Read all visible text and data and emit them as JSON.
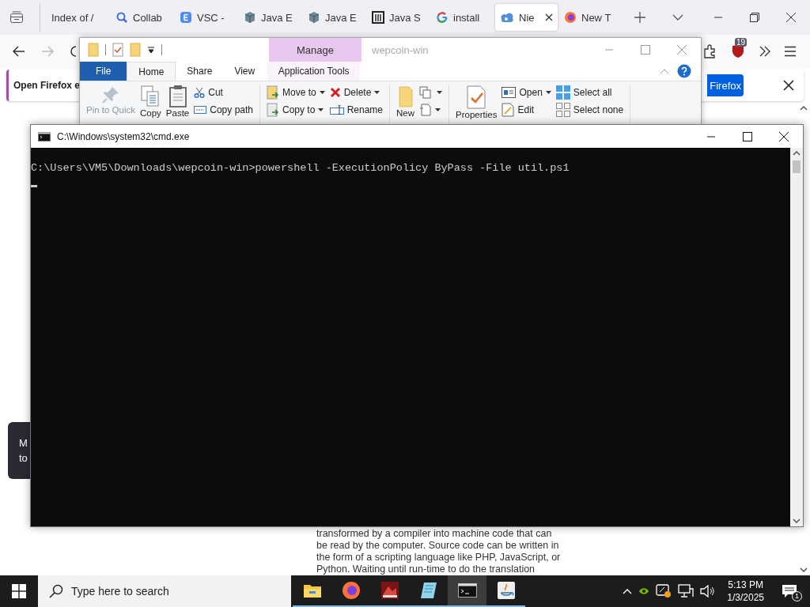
{
  "browser": {
    "tabs": [
      {
        "label": "Index of /",
        "kind": "blank",
        "selected": false
      },
      {
        "label": "Collab",
        "kind": "search",
        "selected": false
      },
      {
        "label": "VSC -",
        "kind": "letter",
        "selected": false
      },
      {
        "label": "Java E",
        "kind": "cube",
        "selected": false
      },
      {
        "label": "Java E",
        "kind": "cube",
        "selected": false
      },
      {
        "label": "Java S",
        "kind": "columns",
        "selected": false
      },
      {
        "label": "install",
        "kind": "google",
        "selected": false
      },
      {
        "label": "Nie",
        "kind": "cloud",
        "selected": true
      },
      {
        "label": "New T",
        "kind": "firefox",
        "selected": false
      }
    ],
    "extension_badge": "19",
    "notification": {
      "text": "Open Firefox e",
      "button": "Firefox"
    },
    "popup_lines": [
      "M",
      "to"
    ],
    "article_lines": [
      "transformed by a compiler into machine code that can",
      "be read by the computer. Source code can be written in",
      "the form of a scripting language like PHP, JavaScript, or",
      "Python. Waiting until run-time to do the translation"
    ]
  },
  "explorer": {
    "title": "wepcoin-win",
    "context_group": "Manage",
    "tabs": [
      {
        "label": "File",
        "kind": "file",
        "selected": false
      },
      {
        "label": "Home",
        "kind": "tab",
        "selected": true
      },
      {
        "label": "Share",
        "kind": "tab",
        "selected": false
      },
      {
        "label": "View",
        "kind": "tab",
        "selected": false
      },
      {
        "label": "Application Tools",
        "kind": "context",
        "selected": false
      }
    ],
    "groups": [
      [
        {
          "kind": "pin",
          "label": "Pin to Quick",
          "disabled": true
        },
        {
          "kind": "copy",
          "label": "Copy",
          "disabled": false
        },
        {
          "kind": "paste",
          "label": "Paste",
          "disabled": false
        },
        {
          "kind": "stack",
          "items": [
            {
              "kind": "scissors",
              "label": "Cut",
              "dropdown": false
            },
            {
              "kind": "path",
              "label": "Copy path",
              "dropdown": false
            }
          ]
        }
      ],
      [
        {
          "kind": "stack",
          "items": [
            {
              "kind": "move",
              "label": "Move to",
              "dropdown": true
            },
            {
              "kind": "copyto",
              "label": "Copy to",
              "dropdown": true
            }
          ]
        },
        {
          "kind": "stack",
          "items": [
            {
              "kind": "delete",
              "label": "Delete",
              "dropdown": true
            },
            {
              "kind": "rename",
              "label": "Rename",
              "dropdown": false
            }
          ]
        }
      ],
      [
        {
          "kind": "folder",
          "label": "New",
          "disabled": false
        },
        {
          "kind": "stack",
          "items": [
            {
              "kind": "newitem",
              "dropdown": true
            },
            {
              "kind": "easy",
              "dropdown": true
            }
          ]
        }
      ],
      [
        {
          "kind": "properties",
          "label": "Properties",
          "disabled": false
        },
        {
          "kind": "stack",
          "items": [
            {
              "kind": "open",
              "label": "Open",
              "dropdown": true
            },
            {
              "kind": "edit",
              "label": "Edit",
              "dropdown": false
            }
          ]
        },
        {
          "kind": "stack",
          "items": [
            {
              "kind": "selectall",
              "label": "Select all",
              "dropdown": false
            },
            {
              "kind": "selectnone",
              "label": "Select none",
              "dropdown": false
            }
          ]
        }
      ]
    ]
  },
  "cmd": {
    "title": "C:\\Windows\\system32\\cmd.exe",
    "lines": [
      "C:\\Users\\VM5\\Downloads\\wepcoin-win>powershell -ExecutionPolicy ByPass -File util.ps1"
    ],
    "cursor": true
  },
  "taskbar": {
    "search_placeholder": "Type here to search",
    "apps": [
      {
        "kind": "explorer",
        "selected": false
      },
      {
        "kind": "firefox",
        "selected": false
      },
      {
        "kind": "game",
        "selected": false
      },
      {
        "kind": "notepad",
        "selected": false
      },
      {
        "kind": "terminal",
        "selected": true
      },
      {
        "kind": "java",
        "selected": false
      }
    ],
    "time": "5:13 PM",
    "date": "1/3/2025",
    "notification_count": "1"
  }
}
